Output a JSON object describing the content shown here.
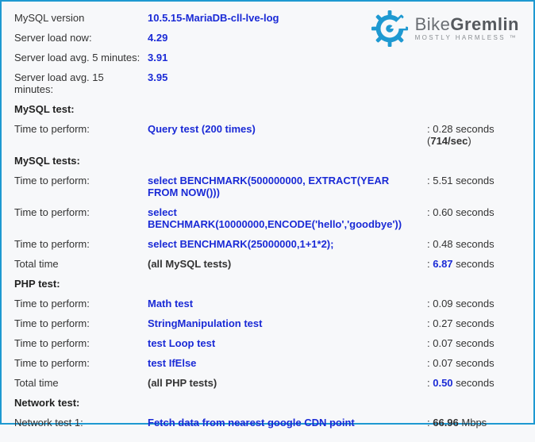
{
  "header": {
    "mysql_version_label": "MySQL version",
    "mysql_version_value": "10.5.15-MariaDB-cll-lve-log",
    "load_now_label": "Server load now:",
    "load_now_value": "4.29",
    "load_5_label": "Server load avg. 5 minutes:",
    "load_5_value": "3.91",
    "load_15_label": "Server load avg. 15 minutes:",
    "load_15_value": "3.95"
  },
  "logo": {
    "brand1": "Bike",
    "brand2": "Gremlin",
    "sub": "MOSTLY HARMLESS ™"
  },
  "mysql_test": {
    "heading": "MySQL test:",
    "row1": {
      "label": "Time to perform:",
      "desc": "Query test (200 times)",
      "time_prefix": ": ",
      "time_num": "0.28",
      "time_suffix": " seconds",
      "rate_prefix": "(",
      "rate_num": "714/sec",
      "rate_suffix": ")"
    }
  },
  "mysql_tests": {
    "heading": "MySQL tests:",
    "rows": [
      {
        "label": "Time to perform:",
        "desc": "select BENCHMARK(500000000, EXTRACT(YEAR FROM NOW()))",
        "time_prefix": ": ",
        "time_num": "5.51",
        "time_suffix": " seconds"
      },
      {
        "label": "Time to perform:",
        "desc": "select BENCHMARK(10000000,ENCODE('hello','goodbye'))",
        "time_prefix": ": ",
        "time_num": "0.60",
        "time_suffix": " seconds"
      },
      {
        "label": "Time to perform:",
        "desc": "select BENCHMARK(25000000,1+1*2);",
        "time_prefix": ": ",
        "time_num": "0.48",
        "time_suffix": " seconds"
      }
    ],
    "total": {
      "label": "Total time",
      "desc": "(all MySQL tests)",
      "time_prefix": ": ",
      "time_num": "6.87",
      "time_suffix": " seconds"
    }
  },
  "php_test": {
    "heading": "PHP test:",
    "rows": [
      {
        "label": "Time to perform:",
        "desc": "Math test",
        "time_prefix": ": ",
        "time_num": "0.09",
        "time_suffix": " seconds"
      },
      {
        "label": "Time to perform:",
        "desc": "StringManipulation test",
        "time_prefix": ": ",
        "time_num": "0.27",
        "time_suffix": " seconds"
      },
      {
        "label": "Time to perform:",
        "desc": "test Loop test",
        "time_prefix": ": ",
        "time_num": "0.07",
        "time_suffix": " seconds"
      },
      {
        "label": "Time to perform:",
        "desc": "test IfElse",
        "time_prefix": ": ",
        "time_num": "0.07",
        "time_suffix": " seconds"
      }
    ],
    "total": {
      "label": "Total time",
      "desc": "(all PHP tests)",
      "time_prefix": ": ",
      "time_num": "0.50",
      "time_suffix": " seconds"
    }
  },
  "network_test": {
    "heading": "Network test:",
    "row1": {
      "label": "Network test 1:",
      "desc": "Fetch data from nearest google CDN point",
      "time_prefix": ": ",
      "time_num": "66.96",
      "time_suffix": " Mbps"
    }
  }
}
